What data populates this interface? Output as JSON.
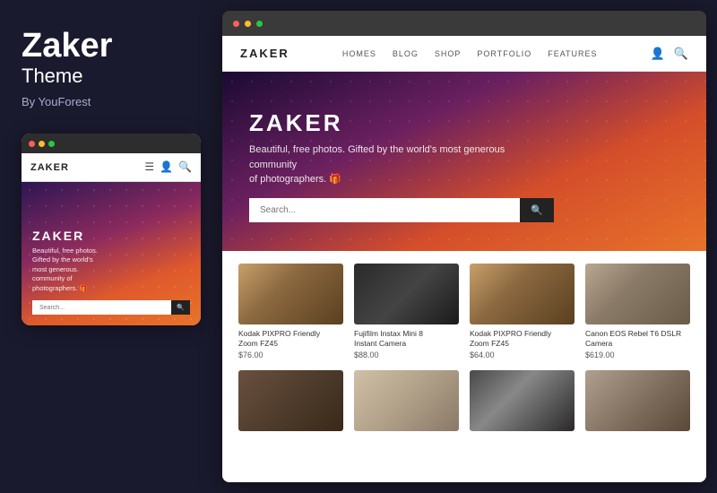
{
  "leftPanel": {
    "brand": "Zaker",
    "subtitle": "Theme",
    "author": "By YouForest"
  },
  "mobilePreview": {
    "windowDots": [
      "red",
      "yellow",
      "green"
    ],
    "navBrand": "ZAKER",
    "heroTitle": "ZAKER",
    "heroText": "Beautiful, free photos.\nGifted by the world's\nmost generous\ncommunity of\nphotographers. 🎁",
    "searchPlaceholder": "Search..."
  },
  "desktopPreview": {
    "windowDots": [
      "red",
      "yellow",
      "green"
    ],
    "navBrand": "ZAKER",
    "navLinks": [
      "HOMES",
      "BLOG",
      "SHOP",
      "PORTFOLIO",
      "FEATURES"
    ],
    "heroTitle": "ZAKER",
    "heroText": "Beautiful, free photos. Gifted by the world's most generous community\nof photographers. 🎁",
    "searchPlaceholder": "Search...",
    "products": [
      {
        "name": "Kodak PIXPRO Friendly\nZoom FZ45",
        "price": "$76.00",
        "imgClass": "cam1"
      },
      {
        "name": "Fujifilm Instax Mini 8\nInstant Camera",
        "price": "$88.00",
        "imgClass": "cam2"
      },
      {
        "name": "Kodak PIXPRO Friendly\nZoom FZ45",
        "price": "$64.00",
        "imgClass": "cam3"
      },
      {
        "name": "Canon EOS Rebel T6 DSLR\nCamera",
        "price": "$619.00",
        "imgClass": "cam4"
      },
      {
        "name": "",
        "price": "",
        "imgClass": "cam5"
      },
      {
        "name": "",
        "price": "",
        "imgClass": "cam6"
      },
      {
        "name": "",
        "price": "",
        "imgClass": "cam7"
      },
      {
        "name": "",
        "price": "",
        "imgClass": "cam8"
      }
    ]
  }
}
